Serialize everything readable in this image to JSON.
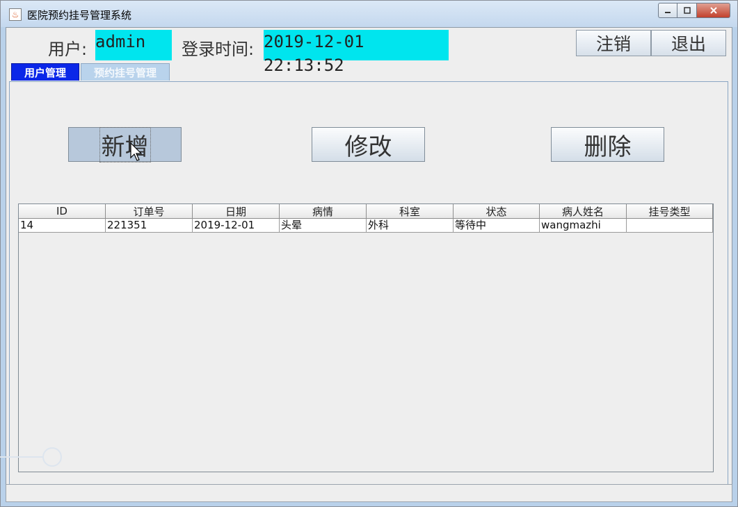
{
  "window": {
    "title": "医院预约挂号管理系统",
    "icon": "java-cup-icon",
    "controls": {
      "minimize": "minimize-icon",
      "maximize": "maximize-icon",
      "close": "close-icon"
    }
  },
  "header": {
    "user_label": "用户:",
    "user_value": "admin",
    "login_time_label": "登录时间:",
    "login_time_value": "2019-12-01 22:13:52",
    "logout_label": "注销",
    "exit_label": "退出",
    "highlight_color": "#00e5ee"
  },
  "tabs": [
    {
      "label": "用户管理",
      "active": true
    },
    {
      "label": "预约挂号管理",
      "active": false
    }
  ],
  "actions": {
    "add_label": "新增",
    "edit_label": "修改",
    "delete_label": "删除"
  },
  "table": {
    "columns": [
      "ID",
      "订单号",
      "日期",
      "病情",
      "科室",
      "状态",
      "病人姓名",
      "挂号类型"
    ],
    "rows": [
      [
        "14",
        "221351",
        "2019-12-01",
        "头晕",
        "外科",
        "等待中",
        "wangmazhi",
        ""
      ]
    ]
  },
  "colors": {
    "active_tab": "#0b27e8",
    "inactive_tab": "#b9d3ec",
    "titlebar": "#c4d8ee"
  }
}
